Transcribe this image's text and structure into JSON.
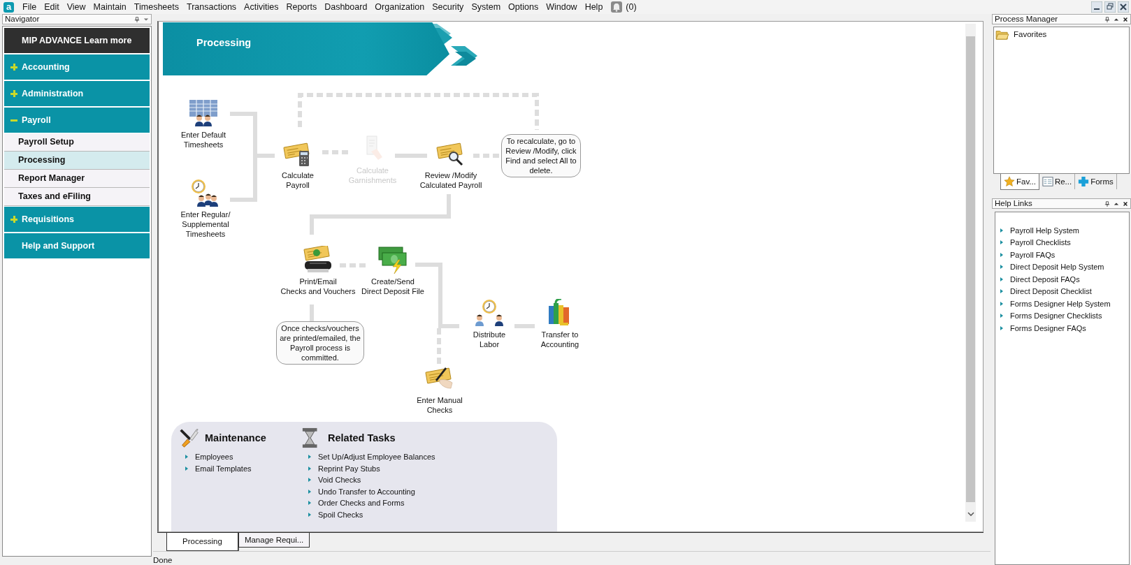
{
  "menu_bar": {
    "logo": "a",
    "items": [
      "File",
      "Edit",
      "View",
      "Maintain",
      "Timesheets",
      "Transactions",
      "Activities",
      "Reports",
      "Dashboard",
      "Organization",
      "Security",
      "System",
      "Options",
      "Window",
      "Help"
    ],
    "notifications": "(0)"
  },
  "navigator": {
    "title": "Navigator",
    "items": [
      {
        "kind": "promo",
        "label": "MIP ADVANCE Learn more"
      },
      {
        "kind": "group",
        "label": "Accounting",
        "expanded": false
      },
      {
        "kind": "group",
        "label": "Administration",
        "expanded": false
      },
      {
        "kind": "group",
        "label": "Payroll",
        "expanded": true,
        "children": [
          {
            "label": "Payroll Setup",
            "selected": false
          },
          {
            "label": "Processing",
            "selected": true
          },
          {
            "label": "Report Manager",
            "selected": false
          },
          {
            "label": "Taxes and eFiling",
            "selected": false
          }
        ]
      },
      {
        "kind": "group",
        "label": "Requisitions",
        "expanded": false
      },
      {
        "kind": "link",
        "label": "Help and Support"
      }
    ]
  },
  "document": {
    "banner": "Processing",
    "workflow": {
      "steps": [
        {
          "label": "Enter Default\nTimesheets",
          "disabled": false
        },
        {
          "label": "Enter Regular/\nSupplemental\nTimesheets",
          "disabled": false
        },
        {
          "label": "Calculate\nPayroll",
          "disabled": false
        },
        {
          "label": "Calculate\nGarnishments",
          "disabled": true
        },
        {
          "label": "Review /Modify\nCalculated Payroll",
          "disabled": false
        },
        {
          "label": "Print/Email\nChecks and Vouchers",
          "disabled": false
        },
        {
          "label": "Create/Send\nDirect Deposit File",
          "disabled": false
        },
        {
          "label": "Distribute\nLabor",
          "disabled": false
        },
        {
          "label": "Transfer to\nAccounting",
          "disabled": false
        },
        {
          "label": "Enter Manual\nChecks",
          "disabled": false
        }
      ],
      "notes": [
        "To recalculate, go to Review /Modify, click Find and select All to delete.",
        "Once checks/vouchers are printed/emailed, the Payroll process is committed."
      ]
    },
    "maintenance": {
      "title": "Maintenance",
      "links": [
        "Employees",
        "Email Templates"
      ]
    },
    "related_tasks": {
      "title": "Related Tasks",
      "links": [
        "Set Up/Adjust Employee Balances",
        "Reprint Pay Stubs",
        "Void Checks",
        "Undo Transfer to Accounting",
        "Order Checks and Forms",
        "Spoil Checks"
      ]
    }
  },
  "document_tabs": [
    {
      "label": "Processing",
      "selected": true
    },
    {
      "label": "Manage Requi...",
      "selected": false
    }
  ],
  "status_bar": "Done",
  "process_manager": {
    "title": "Process Manager",
    "items": [
      "Favorites"
    ],
    "tabs": [
      {
        "label": "Fav...",
        "selected": true
      },
      {
        "label": "Re...",
        "selected": false
      },
      {
        "label": "Forms",
        "selected": false
      }
    ]
  },
  "help_links": {
    "title": "Help Links",
    "links": [
      "Payroll Help System",
      "Payroll Checklists",
      "Payroll FAQs",
      "Direct Deposit Help System",
      "Direct Deposit FAQs",
      "Direct Deposit Checklist",
      "Forms Designer Help System",
      "Forms Designer Checklists",
      "Forms Designer FAQs"
    ]
  }
}
